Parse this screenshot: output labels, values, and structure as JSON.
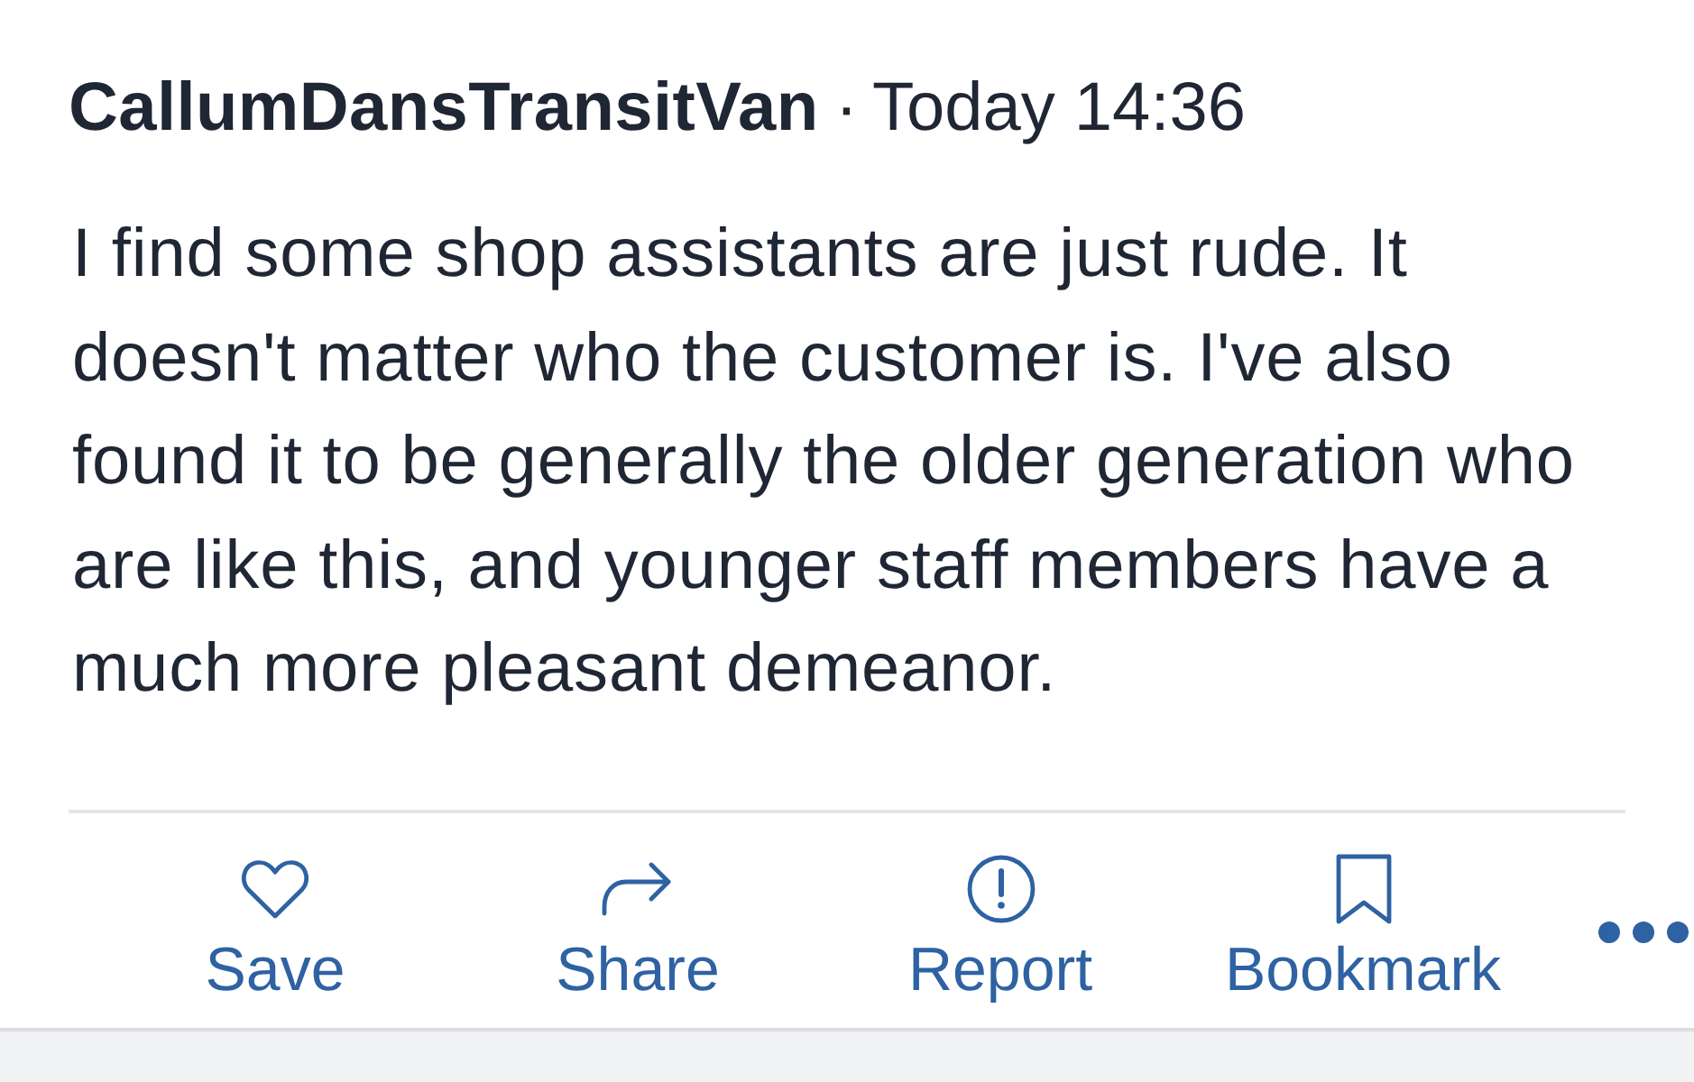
{
  "post": {
    "author": "CallumDansTransitVan",
    "separator": "·",
    "time": "Today 14:36",
    "body": "I find some shop assistants are just rude. It doesn't matter who the customer is. I've also found it to be generally the older generation who are like this, and younger staff members have a much more pleasant demeanor."
  },
  "actions": [
    {
      "label": "Save"
    },
    {
      "label": "Share"
    },
    {
      "label": "Report"
    },
    {
      "label": "Bookmark"
    }
  ]
}
